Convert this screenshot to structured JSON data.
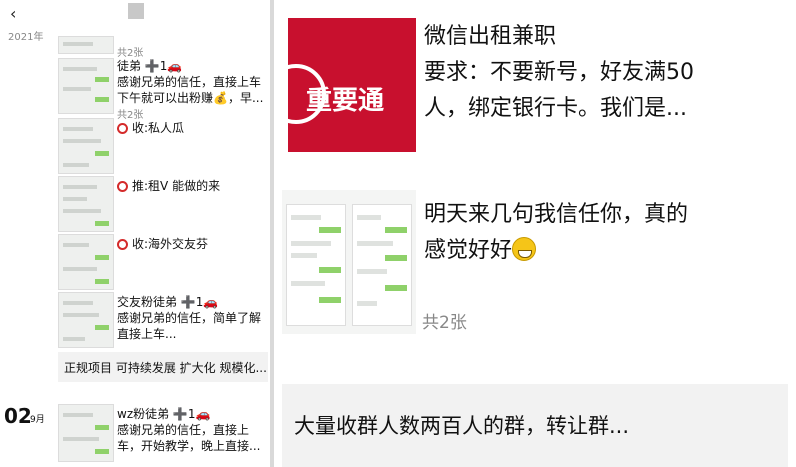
{
  "header": {
    "back_icon": "chevron-left-icon",
    "back_glyph": "‹",
    "year": "2021年"
  },
  "left_posts": [
    {
      "count": "共2张"
    },
    {
      "title": "徒弟 ➕1🚗",
      "line1": "感谢兄弟的信任，直接上车",
      "line2": "下午就可以出粉赚💰，早...",
      "count": "共2张"
    },
    {
      "text": "收:私人瓜"
    },
    {
      "text": "推:租V 能做的来"
    },
    {
      "text": "收:海外交友芬"
    },
    {
      "title": "交友粉徒弟 ➕1🚗",
      "line1": "感谢兄弟的信任，简单了解",
      "line2": "直接上车..."
    }
  ],
  "banner_text": "正规项目 可持续发展 扩大化 规模化...",
  "date_group": {
    "day": "02",
    "month": "9月"
  },
  "last_post": {
    "title": "wz粉徒弟 ➕1🚗",
    "line1": "感谢兄弟的信任，直接上",
    "line2": "车，开始教学，晚上直接..."
  },
  "right": {
    "image_text": "重要通",
    "post1": {
      "line1": "微信出租兼职",
      "line2": "要求：不要新号，好友满50",
      "line3": "人，绑定银行卡。我们是..."
    },
    "post2": {
      "line1": "明天来几句我信任你，真的",
      "line2": "感觉好好",
      "emoji": "grinning-face-icon",
      "count": "共2张"
    },
    "post3": {
      "text": "大量收群人数两百人的群，转让群..."
    }
  },
  "colors": {
    "accent_red": "#d42a2a",
    "brand_red": "#c8102e",
    "wechat_green": "#8fd16a"
  }
}
